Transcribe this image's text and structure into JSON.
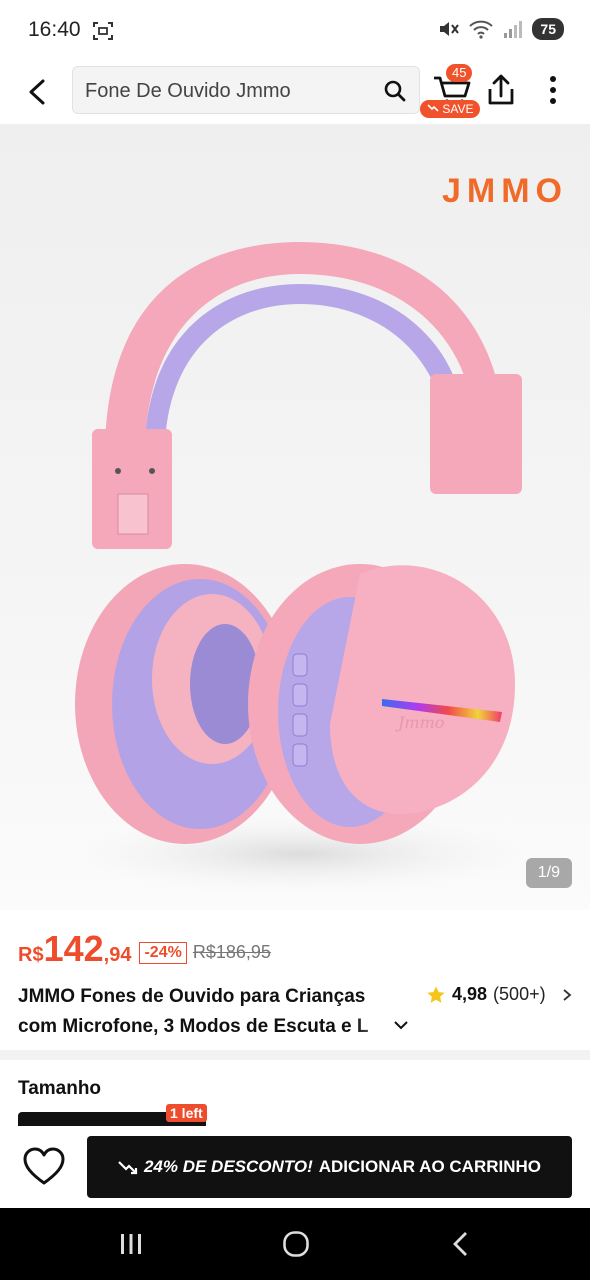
{
  "status_bar": {
    "time": "16:40",
    "battery": "75",
    "icons": [
      "screenshot-icon",
      "mute-icon",
      "wifi-icon",
      "signal-icon",
      "battery-icon"
    ]
  },
  "header": {
    "search_value": "Fone De Ouvido Jmmo",
    "cart_count": "45",
    "save_label": "SAVE",
    "icons": [
      "back-arrow-icon",
      "search-icon",
      "cart-icon",
      "share-icon",
      "more-vertical-icon"
    ]
  },
  "product_image": {
    "brand_logo": "JMMO",
    "counter": "1/9",
    "headphone_brand_text": "Jmmo"
  },
  "price": {
    "currency": "R$",
    "integer": "142",
    "decimal": ",94",
    "discount": "-24%",
    "old_price": "R$186,95"
  },
  "product": {
    "title_line1": "JMMO Fones de Ouvido para Crianças",
    "title_line2": "com Microfone, 3 Modos de Escuta e L",
    "rating_value": "4,98",
    "rating_count": "(500+)"
  },
  "size": {
    "label": "Tamanho",
    "stock_badge": "1 left"
  },
  "action_bar": {
    "discount_text": "24% DE DESCONTO!",
    "add_to_cart": "ADICIONAR AO CARRINHO"
  },
  "colors": {
    "accent": "#ee4d2d",
    "brand_orange": "#f06a2a",
    "button_dark": "#111111",
    "star": "#f5c518",
    "headphone_pink": "#f3a9b9",
    "headphone_lavender": "#b9a9e6"
  }
}
